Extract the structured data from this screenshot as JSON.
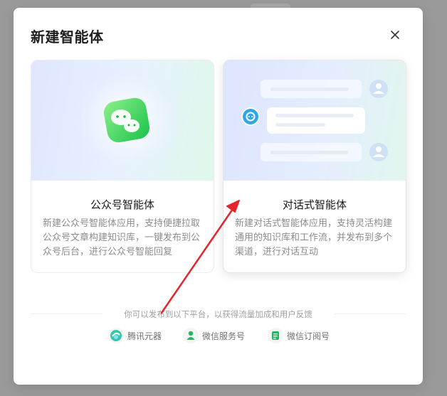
{
  "dialog": {
    "title": "新建智能体"
  },
  "cards": [
    {
      "title": "公众号智能体",
      "description": "新建公众号智能体应用，支持便捷拉取公众号文章构建知识库，一键发布到公众号后台，进行公众号智能回复"
    },
    {
      "title": "对话式智能体",
      "description": "新建对话式智能体应用，支持灵活构建通用的知识库和工作流，并发布到多个渠道，进行对话互动"
    }
  ],
  "footer": {
    "hint": "你可以发布到以下平台，以获得流量加成和用户反馈",
    "platforms": [
      {
        "label": "腾讯元器",
        "icon": "yuanqi-icon"
      },
      {
        "label": "微信服务号",
        "icon": "wechat-service-account-icon"
      },
      {
        "label": "微信订阅号",
        "icon": "wechat-subscription-account-icon"
      }
    ]
  },
  "colors": {
    "wechat_green": "#2ecc71",
    "accent_blue": "#3aa8ff",
    "annotation_arrow": "#e3262b"
  }
}
